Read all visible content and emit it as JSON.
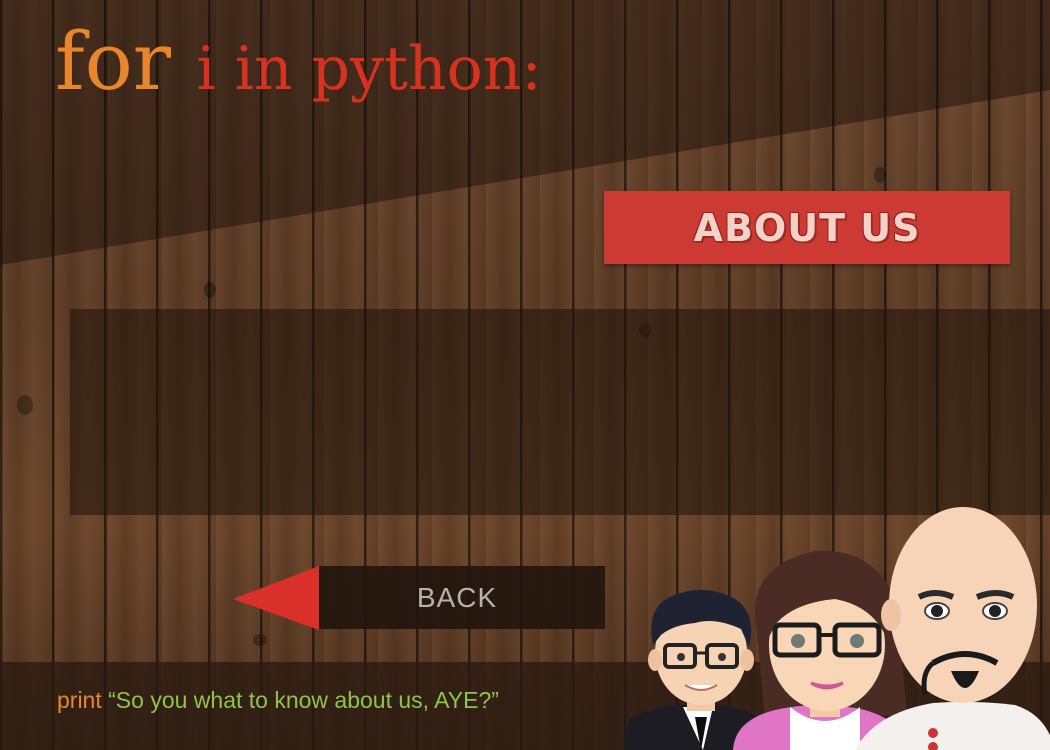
{
  "title": {
    "keyword": "for",
    "rest": "i in python:"
  },
  "about_banner": {
    "label": "ABOUT US"
  },
  "back_button": {
    "label": "BACK"
  },
  "footer": {
    "keyword": "print",
    "text": "“So you what to know about us, AYE?”"
  },
  "characters": [
    "boy-avatar",
    "girl-avatar",
    "bald-man-avatar"
  ],
  "colors": {
    "keyword_orange": "#e8862e",
    "title_red": "#d7321f",
    "banner_red": "#cd3a33",
    "string_green": "#8dc44a",
    "arrow_red": "#d9302a"
  }
}
